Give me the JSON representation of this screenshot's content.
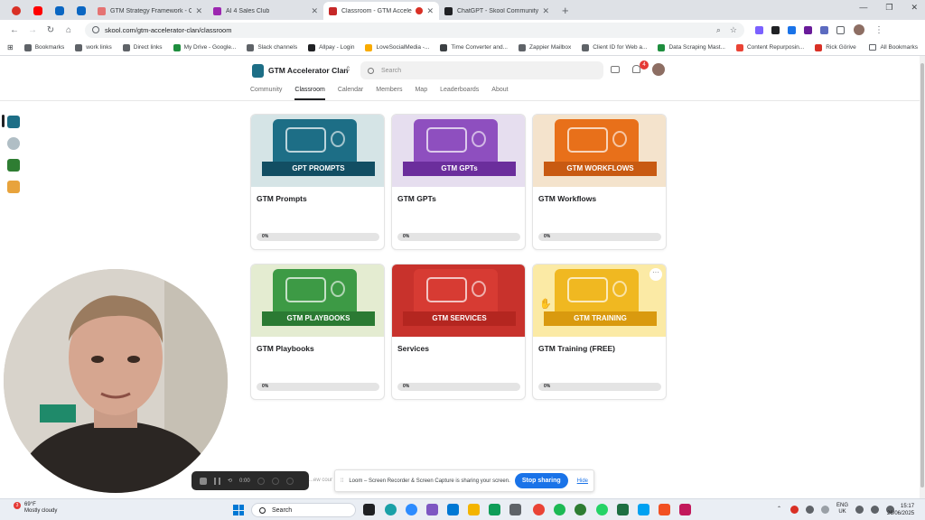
{
  "browser": {
    "tabs": [
      {
        "title": "GTM Strategy Framework - Cla",
        "favicon_color": "#e57373",
        "active": false
      },
      {
        "title": "AI 4 Sales Club",
        "favicon_color": "#9c27b0",
        "active": false
      },
      {
        "title": "Classroom - GTM Accelerat",
        "favicon_color": "#c62828",
        "active": true
      },
      {
        "title": "ChatGPT - Skool Community B",
        "favicon_color": "#202124",
        "active": false
      }
    ],
    "url": "skool.com/gtm-accelerator-clan/classroom",
    "bookmarks": [
      {
        "label": "Bookmarks",
        "icon_color": "#5f6368"
      },
      {
        "label": "work links",
        "icon_color": "#5f6368"
      },
      {
        "label": "Direct links",
        "icon_color": "#5f6368"
      },
      {
        "label": "My Drive - Google...",
        "icon_color": "#1e8e3e"
      },
      {
        "label": "Slack channels",
        "icon_color": "#5f6368"
      },
      {
        "label": "Allpay - Login",
        "icon_color": "#202124"
      },
      {
        "label": "LoveSocialMedia -...",
        "icon_color": "#f9ab00"
      },
      {
        "label": "Time Converter and...",
        "icon_color": "#3c4043"
      },
      {
        "label": "Zappier Mailbox",
        "icon_color": "#5f6368"
      },
      {
        "label": "Client ID for Web a...",
        "icon_color": "#5f6368"
      },
      {
        "label": "Data Scraping Mast...",
        "icon_color": "#1e8e3e"
      },
      {
        "label": "Content Repurposin...",
        "icon_color": "#ea4335"
      },
      {
        "label": "Rick Görive",
        "icon_color": "#d93025"
      }
    ],
    "all_bookmarks": "All Bookmarks"
  },
  "skool": {
    "group_name": "GTM Accelerator Clan",
    "search_placeholder": "Search",
    "notification_count": "4",
    "nav": [
      {
        "label": "Community",
        "active": false
      },
      {
        "label": "Classroom",
        "active": true
      },
      {
        "label": "Calendar",
        "active": false
      },
      {
        "label": "Members",
        "active": false
      },
      {
        "label": "Map",
        "active": false
      },
      {
        "label": "Leaderboards",
        "active": false
      },
      {
        "label": "About",
        "active": false
      }
    ]
  },
  "courses": [
    {
      "title": "GTM Prompts",
      "banner": "GPT PROMPTS",
      "progress_label": "0%",
      "progress": 0,
      "bg": "#d5e4e6",
      "shield": "#1d6e86",
      "ribbon": "#124e63"
    },
    {
      "title": "GTM GPTs",
      "banner": "GTM GPTs",
      "progress_label": "0%",
      "progress": 0,
      "bg": "#e6deef",
      "shield": "#8e4fbf",
      "ribbon": "#6b2e9c"
    },
    {
      "title": "GTM Workflows",
      "banner": "GTM WORKFLOWS",
      "progress_label": "0%",
      "progress": 0,
      "bg": "#f4e3cc",
      "shield": "#e8701a",
      "ribbon": "#c85a12"
    },
    {
      "title": "GTM Playbooks",
      "banner": "GTM PLAYBOOKS",
      "progress_label": "0%",
      "progress": 0,
      "bg": "#e4ecd1",
      "shield": "#3d9a45",
      "ribbon": "#2b7a33"
    },
    {
      "title": "Services",
      "banner": "GTM SERVICES",
      "progress_label": "0%",
      "progress": 0,
      "bg": "#c8322c",
      "shield": "#d73b33",
      "ribbon": "#b42620"
    },
    {
      "title": "GTM Training (FREE)",
      "banner": "GTM TRAINING",
      "progress_label": "0%",
      "progress": 0,
      "bg": "#fbeaa5",
      "shield": "#f0b821",
      "ribbon": "#d99a0f"
    }
  ],
  "loom": {
    "timer": "0:00",
    "partial_text": "...ew cour",
    "share_message": "Loom – Screen Recorder & Screen Capture is sharing your screen.",
    "stop_label": "Stop sharing",
    "hide_label": "Hide"
  },
  "taskbar": {
    "weather_badge": "3",
    "temperature": "69°F",
    "condition": "Mostly cloudy",
    "search_label": "Search",
    "lang_top": "ENG",
    "lang_bottom": "UK",
    "time": "15:17",
    "date": "26/06/2025"
  }
}
